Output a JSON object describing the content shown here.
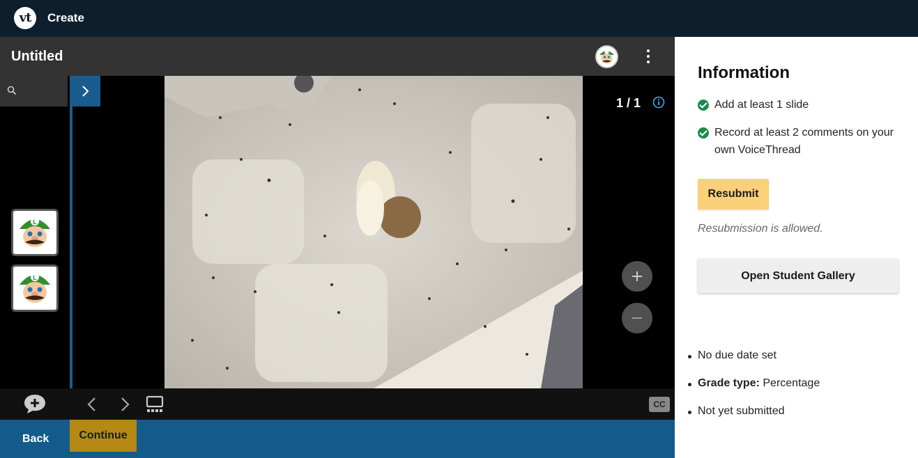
{
  "app": {
    "logo_text": "vt",
    "title": "Create"
  },
  "thread": {
    "title": "Untitled"
  },
  "slide": {
    "counter": "1 / 1"
  },
  "controls": {
    "cc_label": "CC"
  },
  "footer": {
    "back_label": "Back",
    "continue_label": "Continue"
  },
  "info": {
    "heading": "Information",
    "requirements": [
      {
        "text": "Add at least 1 slide",
        "done": true
      },
      {
        "text": "Record at least 2 comments on your own VoiceThread",
        "done": true
      }
    ],
    "resubmit_label": "Resubmit",
    "resubmission_note": "Resubmission is allowed.",
    "gallery_label": "Open Student Gallery",
    "due_date": "No due date set",
    "grade_type_label": "Grade type:",
    "grade_type_value": "Percentage",
    "submission_status": "Not yet submitted"
  },
  "colors": {
    "topbar": "#0d1f2d",
    "accent_blue": "#125b8a",
    "continue": "#b58913",
    "resubmit": "#fbd07a",
    "check_green": "#1e8a4c"
  }
}
